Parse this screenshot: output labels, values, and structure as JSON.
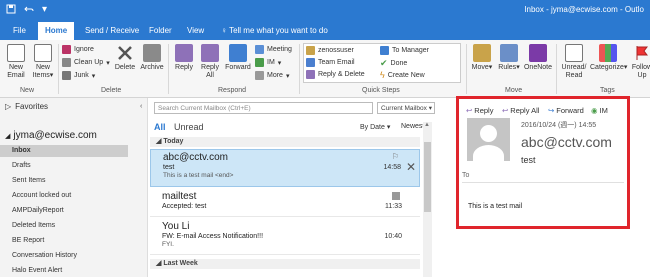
{
  "window": {
    "title": "Inbox - jyma@ecwise.com - Outlo"
  },
  "tabs": [
    "File",
    "Home",
    "Send / Receive",
    "Folder",
    "View",
    "Tell me what you want to do"
  ],
  "ribbon": {
    "new_email": [
      "New",
      "Email"
    ],
    "new_items": [
      "New",
      "Items"
    ],
    "ignore": "Ignore",
    "cleanup": "Clean Up",
    "junk": "Junk",
    "delete": "Delete",
    "archive": "Archive",
    "reply": "Reply",
    "reply_all": [
      "Reply",
      "All"
    ],
    "forward": "Forward",
    "meeting": "Meeting",
    "im": "IM",
    "more": "More",
    "quick_steps": [
      "zenossuser",
      "Team Email",
      "Reply & Delete",
      "To Manager",
      "Done",
      "Create New"
    ],
    "move": "Move",
    "rules": "Rules",
    "onenote": "OneNote",
    "unread_read": [
      "Unread/",
      "Read"
    ],
    "categorize": "Categorize",
    "follow_up": "Follow Up",
    "groups": {
      "new": "New",
      "delete": "Delete",
      "respond": "Respond",
      "quick_steps": "Quick Steps",
      "move": "Move",
      "tags": "Tags"
    }
  },
  "folders": {
    "favorites": "Favorites",
    "account": "jyma@ecwise.com",
    "items": [
      "Inbox",
      "Drafts",
      "Sent Items",
      "Account locked out",
      "AMPDailyReport",
      "Deleted Items",
      "BE Report",
      "Conversation History",
      "Halo Event Alert"
    ]
  },
  "list": {
    "search_placeholder": "Search Current Mailbox (Ctrl+E)",
    "scope": "Current Mailbox",
    "filter_all": "All",
    "filter_unread": "Unread",
    "sort_by": "By Date",
    "sort_order": "Newest",
    "group_today": "Today",
    "group_last_week": "Last Week",
    "messages": [
      {
        "from": "abc@cctv.com",
        "subject": "test",
        "preview": "This is a test mail <end>",
        "time": "14:58"
      },
      {
        "from": "mailtest",
        "subject": "Accepted: test",
        "preview": "",
        "time": "11:33"
      },
      {
        "from": "You Li",
        "subject": "FW: E-mail Access Notification!!!",
        "preview": "FYI.",
        "time": "10:40"
      }
    ]
  },
  "reading": {
    "reply": "Reply",
    "reply_all": "Reply All",
    "forward": "Forward",
    "im": "IM",
    "date": "2016/10/24 (週一) 14:55",
    "from": "abc@cctv.com",
    "subject": "test",
    "to_label": "To",
    "body": "This is a test mail"
  },
  "colors": {
    "accent": "#2b79d0",
    "highlight_box": "#e0252c",
    "selected_row": "#cde6f7"
  }
}
